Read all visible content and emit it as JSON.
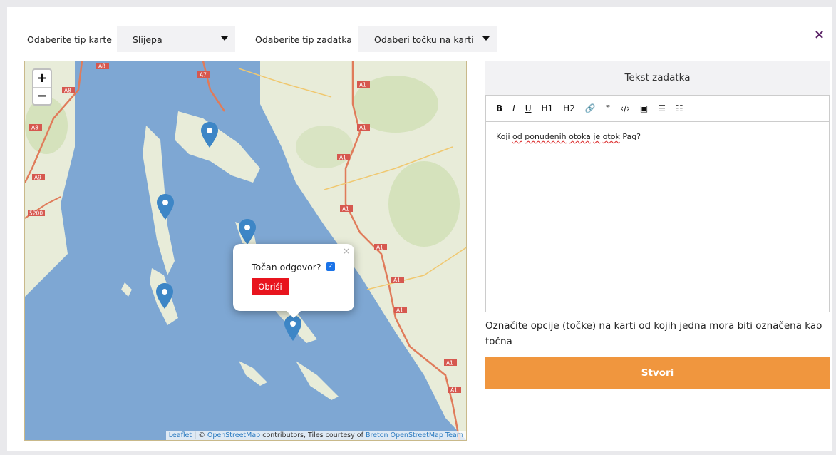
{
  "header": {
    "map_type_label": "Odaberite tip karte",
    "map_type_value": "Slijepa",
    "task_type_label": "Odaberite tip zadatka",
    "task_type_value": "Odaberi točku na karti",
    "close_symbol": "×"
  },
  "map": {
    "zoom_in": "+",
    "zoom_out": "−",
    "road_labels": [
      "A8",
      "A7",
      "A1",
      "A9",
      "5200"
    ],
    "popup": {
      "question": "Točan odgovor?",
      "checked": true,
      "delete_label": "Obriši",
      "close_symbol": "×"
    },
    "attribution": {
      "leaflet": "Leaflet",
      "sep1": " | © ",
      "osm": "OpenStreetMap",
      "mid": " contributors, Tiles courtesy of ",
      "breton": "Breton OpenStreetMap Team"
    },
    "marker_color": "#3d86c6"
  },
  "editor": {
    "title": "Tekst zadatka",
    "toolbar": {
      "bold": "B",
      "italic": "I",
      "underline": "U",
      "h1": "H1",
      "h2": "H2",
      "link": "🔗",
      "quote": "❞",
      "code": "‹/›",
      "image": "▣",
      "ordered_list": "☰",
      "bullet_list": "☷"
    },
    "content_parts": [
      "Koji ",
      "od",
      " ",
      "ponudenih",
      " ",
      "otoka",
      " ",
      "je",
      " ",
      "otok",
      " Pag?"
    ]
  },
  "hint": "Označite opcije (točke) na karti od kojih jedna mora biti označena kao točna",
  "create_button": "Stvori",
  "colors": {
    "accent": "#f0963e",
    "close": "#5a2266",
    "danger": "#e8141e",
    "sea": "#7ea7d3"
  }
}
